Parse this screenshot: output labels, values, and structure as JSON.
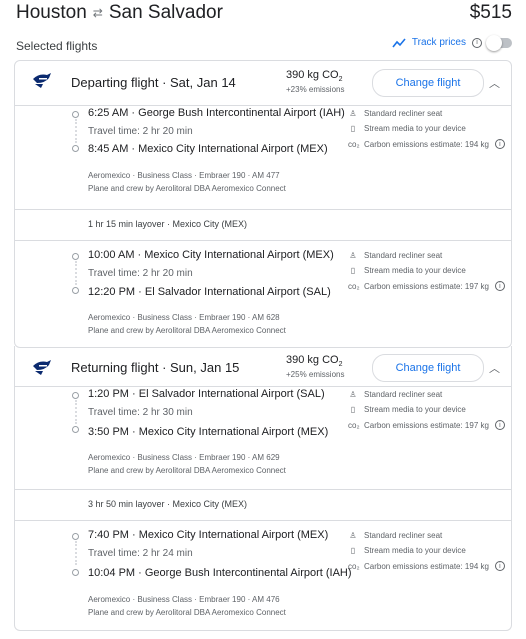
{
  "header": {
    "origin": "Houston",
    "destination": "San Salvador",
    "swap_icon": "swap-arrows-icon",
    "price": "$515",
    "selected_label": "Selected flights",
    "track_label": "Track prices",
    "track_enabled": false
  },
  "departing": {
    "title": "Departing flight",
    "date": "Sat, Jan 14",
    "co2": "390 kg CO",
    "co2_sub": "2",
    "co2_delta": "+23% emissions",
    "change_label": "Change flight",
    "seg1": {
      "dep_time": "6:25 AM",
      "dep_airport": "George Bush Intercontinental Airport (IAH)",
      "travel": "Travel time: 2 hr 20 min",
      "arr_time": "8:45 AM",
      "arr_airport": "Mexico City International Airport (MEX)",
      "meta1": "Aeromexico · Business Class · Embraer 190 · AM 477",
      "meta2": "Plane and crew by Aerolitoral DBA Aeromexico Connect",
      "amen1": "Standard recliner seat",
      "amen2": "Stream media to your device",
      "amen3": "Carbon emissions estimate: 194 kg"
    },
    "layover": "1 hr 15 min layover · Mexico City (MEX)",
    "seg2": {
      "dep_time": "10:00 AM",
      "dep_airport": "Mexico City International Airport (MEX)",
      "travel": "Travel time: 2 hr 20 min",
      "arr_time": "12:20 PM",
      "arr_airport": "El Salvador International Airport (SAL)",
      "meta1": "Aeromexico · Business Class · Embraer 190 · AM 628",
      "meta2": "Plane and crew by Aerolitoral DBA Aeromexico Connect",
      "amen1": "Standard recliner seat",
      "amen2": "Stream media to your device",
      "amen3": "Carbon emissions estimate: 197 kg"
    }
  },
  "returning": {
    "title": "Returning flight",
    "date": "Sun, Jan 15",
    "co2": "390 kg CO",
    "co2_sub": "2",
    "co2_delta": "+25% emissions",
    "change_label": "Change flight",
    "seg1": {
      "dep_time": "1:20 PM",
      "dep_airport": "El Salvador International Airport (SAL)",
      "travel": "Travel time: 2 hr 30 min",
      "arr_time": "3:50 PM",
      "arr_airport": "Mexico City International Airport (MEX)",
      "meta1": "Aeromexico · Business Class · Embraer 190 · AM 629",
      "meta2": "Plane and crew by Aerolitoral DBA Aeromexico Connect",
      "amen1": "Standard recliner seat",
      "amen2": "Stream media to your device",
      "amen3": "Carbon emissions estimate: 197 kg"
    },
    "layover": "3 hr 50 min layover · Mexico City (MEX)",
    "seg2": {
      "dep_time": "7:40 PM",
      "dep_airport": "Mexico City International Airport (MEX)",
      "travel": "Travel time: 2 hr 24 min",
      "arr_time": "10:04 PM",
      "arr_airport": "George Bush Intercontinental Airport (IAH)",
      "meta1": "Aeromexico · Business Class · Embraer 190 · AM 476",
      "meta2": "Plane and crew by Aerolitoral DBA Aeromexico Connect",
      "amen1": "Standard recliner seat",
      "amen2": "Stream media to your device",
      "amen3": "Carbon emissions estimate: 194 kg"
    }
  },
  "colors": {
    "accent": "#1a73e8",
    "border": "#dadce0",
    "muted": "#5f6368"
  }
}
